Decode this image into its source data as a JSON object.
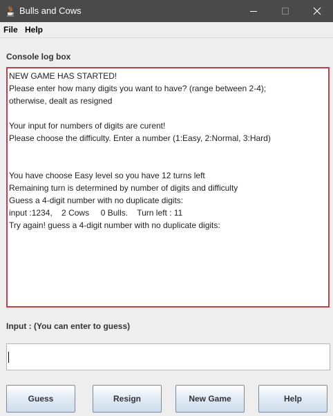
{
  "window": {
    "title": "Bulls and Cows"
  },
  "menubar": {
    "file_label": "File",
    "help_label": "Help"
  },
  "console": {
    "label": "Console log box",
    "lines": [
      "NEW GAME HAS STARTED!",
      "Please enter how many digits you want to have? (range between 2-4);",
      "otherwise, dealt as resigned",
      "",
      "Your input for numbers of digits are curent!",
      "Please choose the difficulty. Enter a number (1:Easy, 2:Normal, 3:Hard)",
      "",
      "",
      "You have choose Easy level so you have 12 turns left",
      "Remaining turn is determined by number of digits and difficulty",
      "Guess a 4-digit number with no duplicate digits:",
      "input :1234,    2 Cows     0 Bulls.    Turn left : 11",
      "Try again! guess a 4-digit number with no duplicate digits:"
    ]
  },
  "input": {
    "label": "Input : (You can enter to guess)",
    "value": ""
  },
  "buttons": {
    "guess": "Guess",
    "resign": "Resign",
    "new_game": "New Game",
    "help": "Help"
  },
  "icons": {
    "app": "java-cup-icon",
    "minimize": "minimize-icon",
    "maximize": "maximize-icon",
    "close": "close-icon"
  },
  "colors": {
    "titlebar": "#4a4a4a",
    "console_border": "#c1404a",
    "background": "#eeeeee"
  }
}
